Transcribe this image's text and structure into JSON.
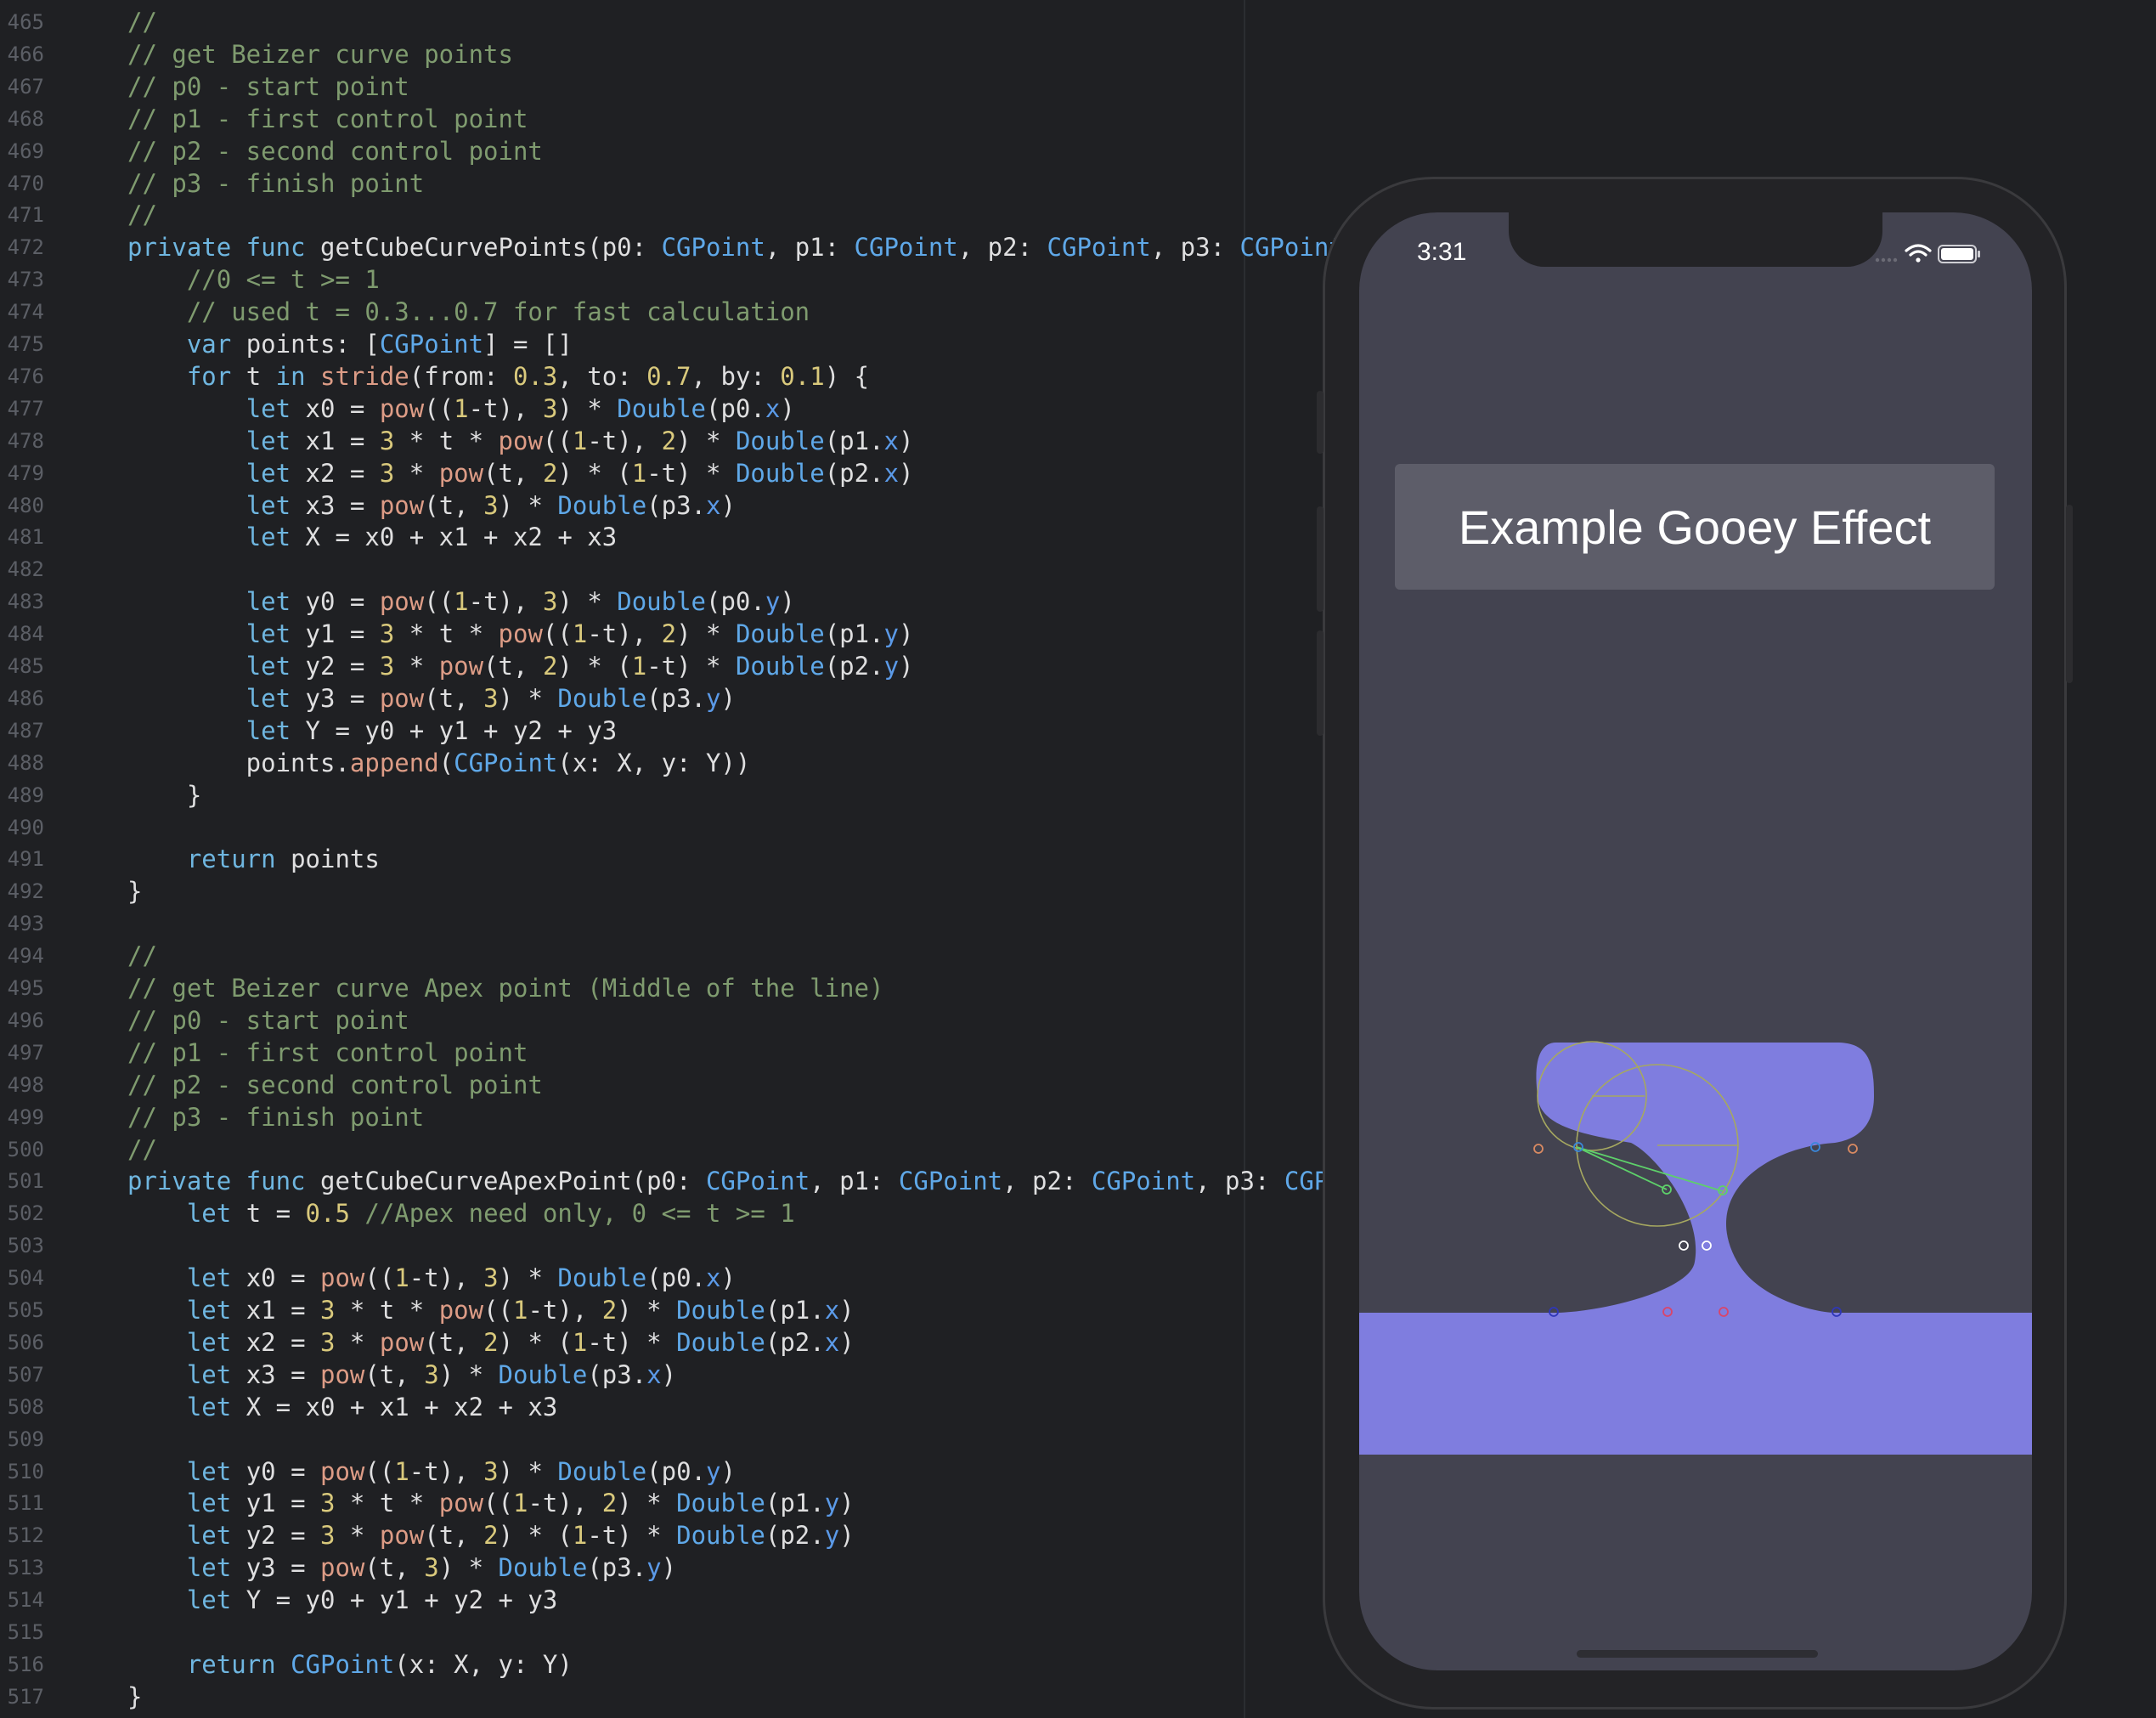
{
  "editor": {
    "gutter_start": 465,
    "lines": [
      [
        [
          "cmt",
          "//"
        ]
      ],
      [
        [
          "cmt",
          "// get Beizer curve points"
        ]
      ],
      [
        [
          "cmt",
          "// p0 - start point"
        ]
      ],
      [
        [
          "cmt",
          "// p1 - first control point"
        ]
      ],
      [
        [
          "cmt",
          "// p2 - second control point"
        ]
      ],
      [
        [
          "cmt",
          "// p3 - finish point"
        ]
      ],
      [
        [
          "cmt",
          "//"
        ]
      ],
      [
        [
          "kw",
          "private func "
        ],
        [
          "plain",
          "getCubeCurvePoints(p0: "
        ],
        [
          "ty",
          "CGPoint"
        ],
        [
          "plain",
          ", p1: "
        ],
        [
          "ty",
          "CGPoint"
        ],
        [
          "plain",
          ", p2: "
        ],
        [
          "ty",
          "CGPoint"
        ],
        [
          "plain",
          ", p3: "
        ],
        [
          "ty",
          "CGPoint"
        ]
      ],
      [
        [
          "plain",
          "    "
        ],
        [
          "cmt",
          "//0 <= t >= 1"
        ]
      ],
      [
        [
          "plain",
          "    "
        ],
        [
          "cmt",
          "// used t = 0.3...0.7 for fast calculation"
        ]
      ],
      [
        [
          "plain",
          "    "
        ],
        [
          "kw",
          "var "
        ],
        [
          "plain",
          "points: ["
        ],
        [
          "ty",
          "CGPoint"
        ],
        [
          "plain",
          "] = []"
        ]
      ],
      [
        [
          "plain",
          "    "
        ],
        [
          "kw",
          "for "
        ],
        [
          "plain",
          "t "
        ],
        [
          "kw",
          "in "
        ],
        [
          "fn",
          "stride"
        ],
        [
          "plain",
          "(from: "
        ],
        [
          "num",
          "0.3"
        ],
        [
          "plain",
          ", to: "
        ],
        [
          "num",
          "0.7"
        ],
        [
          "plain",
          ", by: "
        ],
        [
          "num",
          "0.1"
        ],
        [
          "plain",
          ") {"
        ]
      ],
      [
        [
          "plain",
          "        "
        ],
        [
          "kw",
          "let "
        ],
        [
          "plain",
          "x0 = "
        ],
        [
          "fn",
          "pow"
        ],
        [
          "plain",
          "(("
        ],
        [
          "num",
          "1"
        ],
        [
          "plain",
          "-t), "
        ],
        [
          "num",
          "3"
        ],
        [
          "plain",
          ") * "
        ],
        [
          "ty",
          "Double"
        ],
        [
          "plain",
          "(p0."
        ],
        [
          "prop",
          "x"
        ],
        [
          "plain",
          ")"
        ]
      ],
      [
        [
          "plain",
          "        "
        ],
        [
          "kw",
          "let "
        ],
        [
          "plain",
          "x1 = "
        ],
        [
          "num",
          "3"
        ],
        [
          "plain",
          " * t * "
        ],
        [
          "fn",
          "pow"
        ],
        [
          "plain",
          "(("
        ],
        [
          "num",
          "1"
        ],
        [
          "plain",
          "-t), "
        ],
        [
          "num",
          "2"
        ],
        [
          "plain",
          ") * "
        ],
        [
          "ty",
          "Double"
        ],
        [
          "plain",
          "(p1."
        ],
        [
          "prop",
          "x"
        ],
        [
          "plain",
          ")"
        ]
      ],
      [
        [
          "plain",
          "        "
        ],
        [
          "kw",
          "let "
        ],
        [
          "plain",
          "x2 = "
        ],
        [
          "num",
          "3"
        ],
        [
          "plain",
          " * "
        ],
        [
          "fn",
          "pow"
        ],
        [
          "plain",
          "(t, "
        ],
        [
          "num",
          "2"
        ],
        [
          "plain",
          ") * ("
        ],
        [
          "num",
          "1"
        ],
        [
          "plain",
          "-t) * "
        ],
        [
          "ty",
          "Double"
        ],
        [
          "plain",
          "(p2."
        ],
        [
          "prop",
          "x"
        ],
        [
          "plain",
          ")"
        ]
      ],
      [
        [
          "plain",
          "        "
        ],
        [
          "kw",
          "let "
        ],
        [
          "plain",
          "x3 = "
        ],
        [
          "fn",
          "pow"
        ],
        [
          "plain",
          "(t, "
        ],
        [
          "num",
          "3"
        ],
        [
          "plain",
          ") * "
        ],
        [
          "ty",
          "Double"
        ],
        [
          "plain",
          "(p3."
        ],
        [
          "prop",
          "x"
        ],
        [
          "plain",
          ")"
        ]
      ],
      [
        [
          "plain",
          "        "
        ],
        [
          "kw",
          "let "
        ],
        [
          "plain",
          "X = x0 + x1 + x2 + x3"
        ]
      ],
      [],
      [
        [
          "plain",
          "        "
        ],
        [
          "kw",
          "let "
        ],
        [
          "plain",
          "y0 = "
        ],
        [
          "fn",
          "pow"
        ],
        [
          "plain",
          "(("
        ],
        [
          "num",
          "1"
        ],
        [
          "plain",
          "-t), "
        ],
        [
          "num",
          "3"
        ],
        [
          "plain",
          ") * "
        ],
        [
          "ty",
          "Double"
        ],
        [
          "plain",
          "(p0."
        ],
        [
          "prop",
          "y"
        ],
        [
          "plain",
          ")"
        ]
      ],
      [
        [
          "plain",
          "        "
        ],
        [
          "kw",
          "let "
        ],
        [
          "plain",
          "y1 = "
        ],
        [
          "num",
          "3"
        ],
        [
          "plain",
          " * t * "
        ],
        [
          "fn",
          "pow"
        ],
        [
          "plain",
          "(("
        ],
        [
          "num",
          "1"
        ],
        [
          "plain",
          "-t), "
        ],
        [
          "num",
          "2"
        ],
        [
          "plain",
          ") * "
        ],
        [
          "ty",
          "Double"
        ],
        [
          "plain",
          "(p1."
        ],
        [
          "prop",
          "y"
        ],
        [
          "plain",
          ")"
        ]
      ],
      [
        [
          "plain",
          "        "
        ],
        [
          "kw",
          "let "
        ],
        [
          "plain",
          "y2 = "
        ],
        [
          "num",
          "3"
        ],
        [
          "plain",
          " * "
        ],
        [
          "fn",
          "pow"
        ],
        [
          "plain",
          "(t, "
        ],
        [
          "num",
          "2"
        ],
        [
          "plain",
          ") * ("
        ],
        [
          "num",
          "1"
        ],
        [
          "plain",
          "-t) * "
        ],
        [
          "ty",
          "Double"
        ],
        [
          "plain",
          "(p2."
        ],
        [
          "prop",
          "y"
        ],
        [
          "plain",
          ")"
        ]
      ],
      [
        [
          "plain",
          "        "
        ],
        [
          "kw",
          "let "
        ],
        [
          "plain",
          "y3 = "
        ],
        [
          "fn",
          "pow"
        ],
        [
          "plain",
          "(t, "
        ],
        [
          "num",
          "3"
        ],
        [
          "plain",
          ") * "
        ],
        [
          "ty",
          "Double"
        ],
        [
          "plain",
          "(p3."
        ],
        [
          "prop",
          "y"
        ],
        [
          "plain",
          ")"
        ]
      ],
      [
        [
          "plain",
          "        "
        ],
        [
          "kw",
          "let "
        ],
        [
          "plain",
          "Y = y0 + y1 + y2 + y3"
        ]
      ],
      [
        [
          "plain",
          "        points."
        ],
        [
          "fn",
          "append"
        ],
        [
          "plain",
          "("
        ],
        [
          "ty",
          "CGPoint"
        ],
        [
          "plain",
          "(x: X, y: Y))"
        ]
      ],
      [
        [
          "plain",
          "    }"
        ]
      ],
      [],
      [
        [
          "plain",
          "    "
        ],
        [
          "kw",
          "return "
        ],
        [
          "plain",
          "points"
        ]
      ],
      [
        [
          "plain",
          "}"
        ]
      ],
      [],
      [
        [
          "cmt",
          "//"
        ]
      ],
      [
        [
          "cmt",
          "// get Beizer curve Apex point (Middle of the line)"
        ]
      ],
      [
        [
          "cmt",
          "// p0 - start point"
        ]
      ],
      [
        [
          "cmt",
          "// p1 - first control point"
        ]
      ],
      [
        [
          "cmt",
          "// p2 - second control point"
        ]
      ],
      [
        [
          "cmt",
          "// p3 - finish point"
        ]
      ],
      [
        [
          "cmt",
          "//"
        ]
      ],
      [
        [
          "kw",
          "private func "
        ],
        [
          "plain",
          "getCubeCurveApexPoint(p0: "
        ],
        [
          "ty",
          "CGPoint"
        ],
        [
          "plain",
          ", p1: "
        ],
        [
          "ty",
          "CGPoint"
        ],
        [
          "plain",
          ", p2: "
        ],
        [
          "ty",
          "CGPoint"
        ],
        [
          "plain",
          ", p3: "
        ],
        [
          "ty",
          "CGPo"
        ]
      ],
      [
        [
          "plain",
          "    "
        ],
        [
          "kw",
          "let "
        ],
        [
          "plain",
          "t = "
        ],
        [
          "num",
          "0.5"
        ],
        [
          "plain",
          " "
        ],
        [
          "cmt",
          "//Apex need only, 0 <= t >= 1"
        ]
      ],
      [],
      [
        [
          "plain",
          "    "
        ],
        [
          "kw",
          "let "
        ],
        [
          "plain",
          "x0 = "
        ],
        [
          "fn",
          "pow"
        ],
        [
          "plain",
          "(("
        ],
        [
          "num",
          "1"
        ],
        [
          "plain",
          "-t), "
        ],
        [
          "num",
          "3"
        ],
        [
          "plain",
          ") * "
        ],
        [
          "ty",
          "Double"
        ],
        [
          "plain",
          "(p0."
        ],
        [
          "prop",
          "x"
        ],
        [
          "plain",
          ")"
        ]
      ],
      [
        [
          "plain",
          "    "
        ],
        [
          "kw",
          "let "
        ],
        [
          "plain",
          "x1 = "
        ],
        [
          "num",
          "3"
        ],
        [
          "plain",
          " * t * "
        ],
        [
          "fn",
          "pow"
        ],
        [
          "plain",
          "(("
        ],
        [
          "num",
          "1"
        ],
        [
          "plain",
          "-t), "
        ],
        [
          "num",
          "2"
        ],
        [
          "plain",
          ") * "
        ],
        [
          "ty",
          "Double"
        ],
        [
          "plain",
          "(p1."
        ],
        [
          "prop",
          "x"
        ],
        [
          "plain",
          ")"
        ]
      ],
      [
        [
          "plain",
          "    "
        ],
        [
          "kw",
          "let "
        ],
        [
          "plain",
          "x2 = "
        ],
        [
          "num",
          "3"
        ],
        [
          "plain",
          " * "
        ],
        [
          "fn",
          "pow"
        ],
        [
          "plain",
          "(t, "
        ],
        [
          "num",
          "2"
        ],
        [
          "plain",
          ") * ("
        ],
        [
          "num",
          "1"
        ],
        [
          "plain",
          "-t) * "
        ],
        [
          "ty",
          "Double"
        ],
        [
          "plain",
          "(p2."
        ],
        [
          "prop",
          "x"
        ],
        [
          "plain",
          ")"
        ]
      ],
      [
        [
          "plain",
          "    "
        ],
        [
          "kw",
          "let "
        ],
        [
          "plain",
          "x3 = "
        ],
        [
          "fn",
          "pow"
        ],
        [
          "plain",
          "(t, "
        ],
        [
          "num",
          "3"
        ],
        [
          "plain",
          ") * "
        ],
        [
          "ty",
          "Double"
        ],
        [
          "plain",
          "(p3."
        ],
        [
          "prop",
          "x"
        ],
        [
          "plain",
          ")"
        ]
      ],
      [
        [
          "plain",
          "    "
        ],
        [
          "kw",
          "let "
        ],
        [
          "plain",
          "X = x0 + x1 + x2 + x3"
        ]
      ],
      [],
      [
        [
          "plain",
          "    "
        ],
        [
          "kw",
          "let "
        ],
        [
          "plain",
          "y0 = "
        ],
        [
          "fn",
          "pow"
        ],
        [
          "plain",
          "(("
        ],
        [
          "num",
          "1"
        ],
        [
          "plain",
          "-t), "
        ],
        [
          "num",
          "3"
        ],
        [
          "plain",
          ") * "
        ],
        [
          "ty",
          "Double"
        ],
        [
          "plain",
          "(p0."
        ],
        [
          "prop",
          "y"
        ],
        [
          "plain",
          ")"
        ]
      ],
      [
        [
          "plain",
          "    "
        ],
        [
          "kw",
          "let "
        ],
        [
          "plain",
          "y1 = "
        ],
        [
          "num",
          "3"
        ],
        [
          "plain",
          " * t * "
        ],
        [
          "fn",
          "pow"
        ],
        [
          "plain",
          "(("
        ],
        [
          "num",
          "1"
        ],
        [
          "plain",
          "-t), "
        ],
        [
          "num",
          "2"
        ],
        [
          "plain",
          ") * "
        ],
        [
          "ty",
          "Double"
        ],
        [
          "plain",
          "(p1."
        ],
        [
          "prop",
          "y"
        ],
        [
          "plain",
          ")"
        ]
      ],
      [
        [
          "plain",
          "    "
        ],
        [
          "kw",
          "let "
        ],
        [
          "plain",
          "y2 = "
        ],
        [
          "num",
          "3"
        ],
        [
          "plain",
          " * "
        ],
        [
          "fn",
          "pow"
        ],
        [
          "plain",
          "(t, "
        ],
        [
          "num",
          "2"
        ],
        [
          "plain",
          ") * ("
        ],
        [
          "num",
          "1"
        ],
        [
          "plain",
          "-t) * "
        ],
        [
          "ty",
          "Double"
        ],
        [
          "plain",
          "(p2."
        ],
        [
          "prop",
          "y"
        ],
        [
          "plain",
          ")"
        ]
      ],
      [
        [
          "plain",
          "    "
        ],
        [
          "kw",
          "let "
        ],
        [
          "plain",
          "y3 = "
        ],
        [
          "fn",
          "pow"
        ],
        [
          "plain",
          "(t, "
        ],
        [
          "num",
          "3"
        ],
        [
          "plain",
          ") * "
        ],
        [
          "ty",
          "Double"
        ],
        [
          "plain",
          "(p3."
        ],
        [
          "prop",
          "y"
        ],
        [
          "plain",
          ")"
        ]
      ],
      [
        [
          "plain",
          "    "
        ],
        [
          "kw",
          "let "
        ],
        [
          "plain",
          "Y = y0 + y1 + y2 + y3"
        ]
      ],
      [],
      [
        [
          "plain",
          "    "
        ],
        [
          "kw",
          "return "
        ],
        [
          "ty",
          "CGPoint"
        ],
        [
          "plain",
          "(x: X, y: Y)"
        ]
      ],
      [
        [
          "plain",
          "}"
        ]
      ]
    ]
  },
  "simulator": {
    "status_time": "3:31",
    "title": "Example Gooey Effect",
    "colors": {
      "screen_bg": "#434350",
      "blob_fill": "#7f7ddf",
      "title_bg": "#5d5d69"
    }
  },
  "icons": [
    "signal-dots-icon",
    "wifi-icon",
    "battery-icon"
  ]
}
